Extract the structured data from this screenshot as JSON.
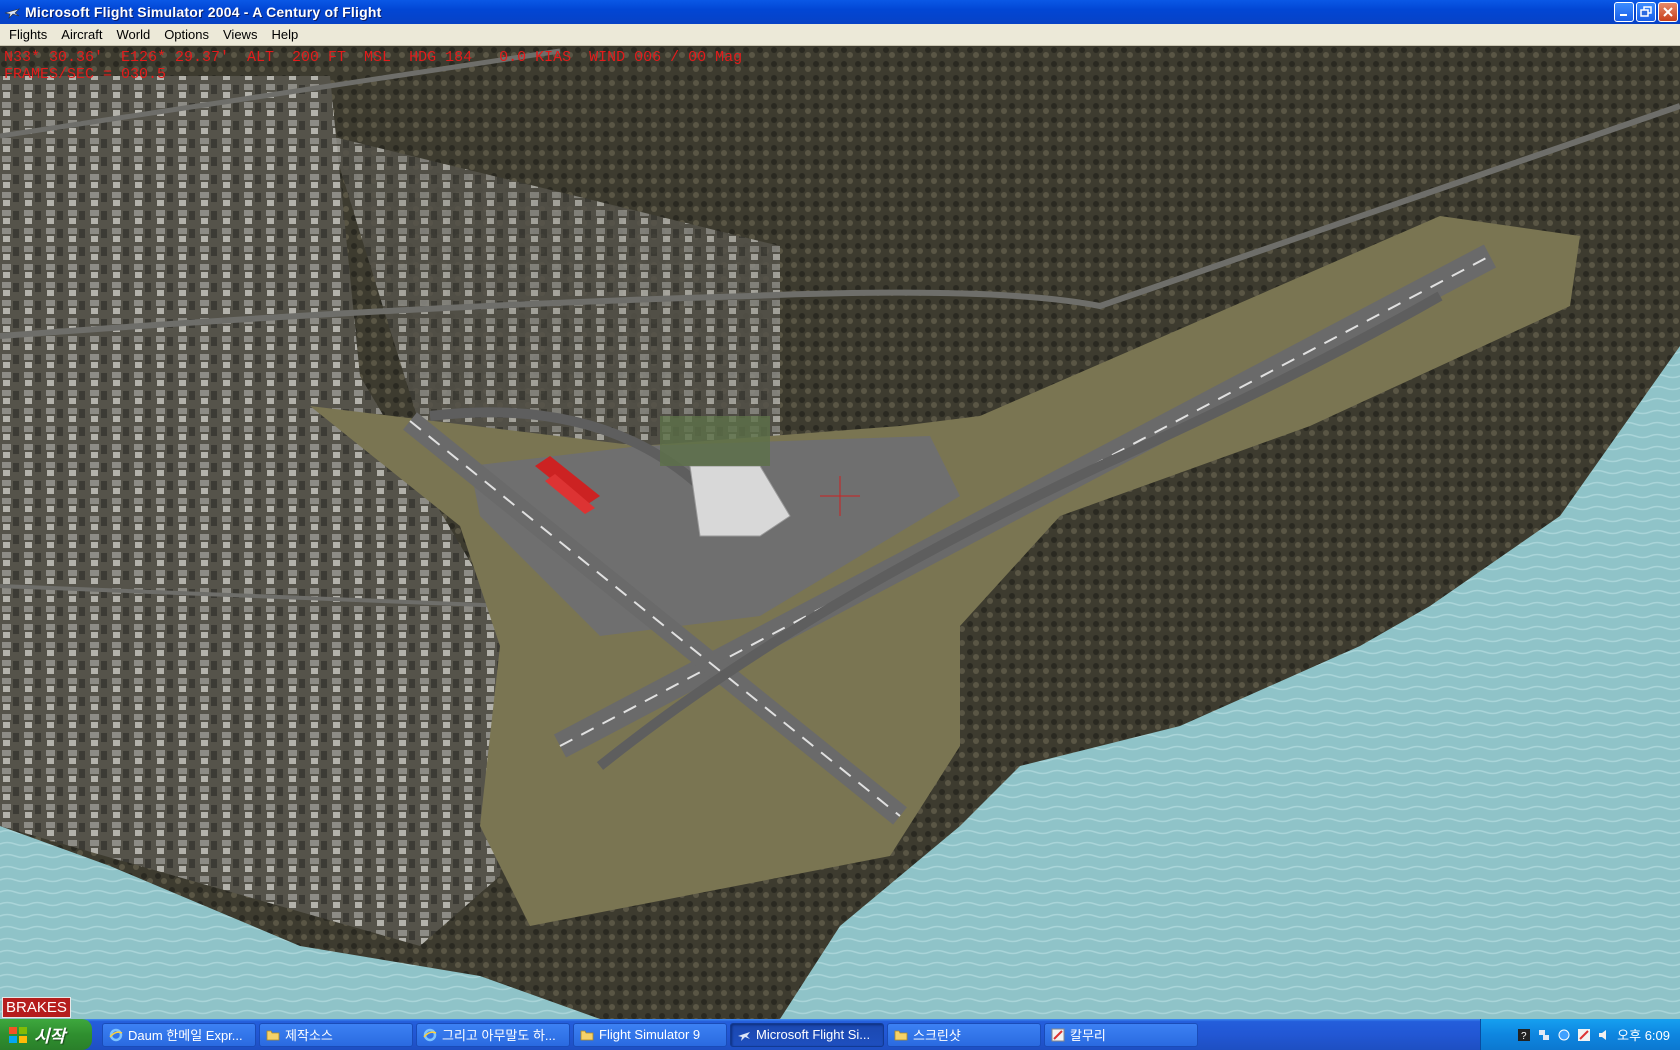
{
  "window": {
    "title": "Microsoft Flight Simulator 2004 - A Century of Flight"
  },
  "menu": [
    "Flights",
    "Aircraft",
    "World",
    "Options",
    "Views",
    "Help"
  ],
  "hud": {
    "line1": "N33* 30.36'  E126* 29.37'  ALT  200 FT  MSL  HDG 184   0.0 KIAS  WIND 006 / 00 Mag",
    "line2": "FRAMES/SEC = 030.5"
  },
  "status_indicator": "BRAKES",
  "taskbar": {
    "start_label": "시작",
    "tasks": [
      {
        "label": "Daum 한메일 Expr...",
        "icon": "ie-icon"
      },
      {
        "label": "제작소스",
        "icon": "folder-icon"
      },
      {
        "label": "그리고 아무말도 하...",
        "icon": "ie-icon"
      },
      {
        "label": "Flight Simulator 9",
        "icon": "folder-icon"
      },
      {
        "label": "Microsoft Flight Si...",
        "icon": "plane-icon"
      },
      {
        "label": "스크린샷",
        "icon": "folder-icon"
      },
      {
        "label": "칼무리",
        "icon": "paint-icon"
      }
    ],
    "active_task": 4,
    "clock": "오후 6:09"
  },
  "colors": {
    "titlebar": "#0a58e6",
    "hud_text": "#e31b1b",
    "sea": "#8fc3c8",
    "land": "#4a4636",
    "airfield_grass": "#7a7552",
    "runway": "#6d6d6d"
  }
}
